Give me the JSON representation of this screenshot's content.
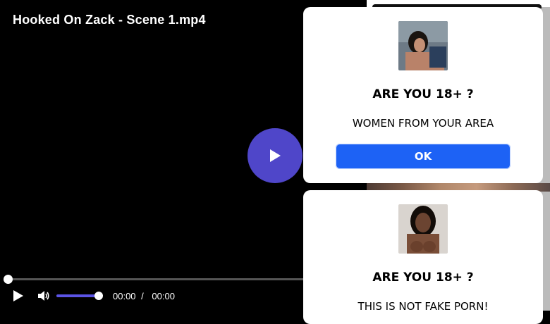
{
  "player": {
    "title": "Hooked On Zack - Scene 1.mp4",
    "progress": 0,
    "volume": 0.85,
    "time_current": "00:00",
    "time_separator": "/",
    "time_total": "00:00",
    "accent_color": "#4f46c9"
  },
  "popups": [
    {
      "heading": "ARE YOU 18+ ?",
      "text": "WOMEN FROM YOUR AREA",
      "button_label": "OK",
      "button_color": "#1d62f5"
    },
    {
      "heading": "ARE YOU 18+ ?",
      "text": "THIS IS NOT FAKE PORN!"
    }
  ]
}
